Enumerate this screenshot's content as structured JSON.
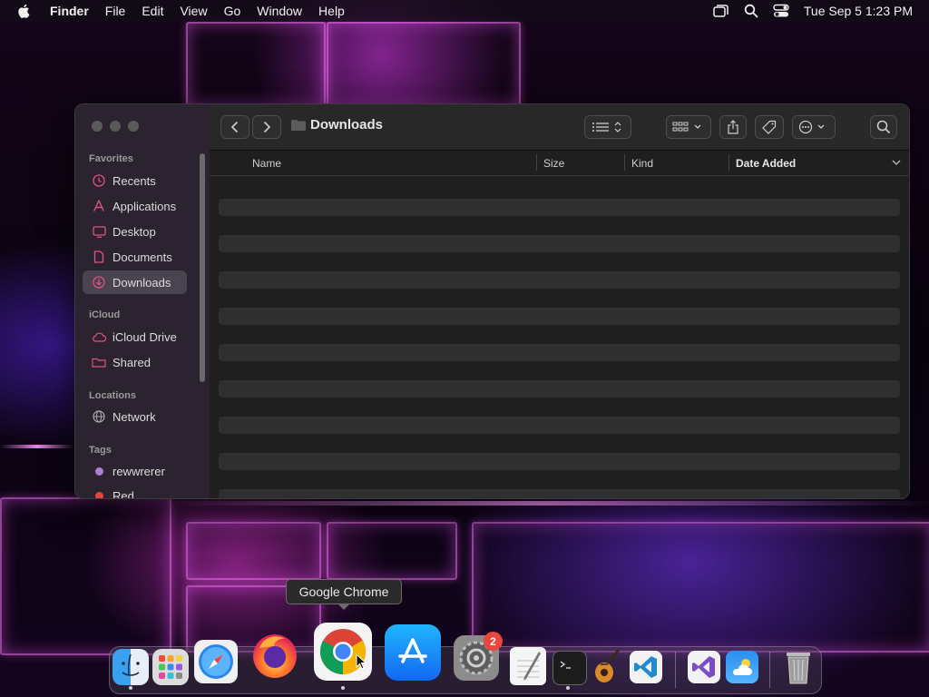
{
  "menubar": {
    "app_name": "Finder",
    "items": [
      "File",
      "Edit",
      "View",
      "Go",
      "Window",
      "Help"
    ],
    "clock": "Tue Sep 5  1:23 PM"
  },
  "finder": {
    "title": "Downloads",
    "sidebar": {
      "favorites_label": "Favorites",
      "favorites": [
        "Recents",
        "Applications",
        "Desktop",
        "Documents",
        "Downloads"
      ],
      "icloud_label": "iCloud",
      "icloud": [
        "iCloud Drive",
        "Shared"
      ],
      "locations_label": "Locations",
      "locations": [
        "Network"
      ],
      "tags_label": "Tags",
      "tags": [
        {
          "name": "rewwrerer",
          "color": "#b07cd6"
        },
        {
          "name": "Red",
          "color": "#e5453c"
        }
      ]
    },
    "columns": [
      "Name",
      "Size",
      "Kind",
      "Date Added"
    ],
    "row_count": 9
  },
  "dock": {
    "tooltip": "Google Chrome",
    "settings_badge": "2",
    "apps": [
      "Finder",
      "Launchpad",
      "Safari",
      "Firefox",
      "Google Chrome",
      "App Store",
      "System Settings",
      "TextEdit",
      "Terminal",
      "GarageBand",
      "Visual Studio Code",
      "Visual Studio",
      "Weather",
      "Trash"
    ]
  },
  "colors": {
    "accent_pink": "#e0508a",
    "window_bg": "#1f1f1f",
    "sidebar_bg": "#2b2430"
  }
}
